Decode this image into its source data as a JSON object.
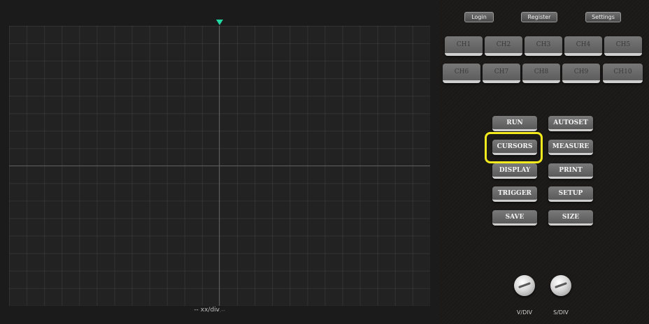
{
  "header": {
    "login_label": "Login",
    "register_label": "Register",
    "settings_label": "Settings"
  },
  "channels": [
    "CH1",
    "CH2",
    "CH3",
    "CH4",
    "CH5",
    "CH6",
    "CH7",
    "CH8",
    "CH9",
    "CH10"
  ],
  "controls": {
    "run": "RUN",
    "autoset": "AUTOSET",
    "cursors": "CURSORS",
    "measure": "MEASURE",
    "display": "DISPLAY",
    "print": "PRINT",
    "trigger": "TRIGGER",
    "setup": "SETUP",
    "save": "SAVE",
    "size": "SIZE"
  },
  "screen": {
    "time_readout": "--.--",
    "scale_readout": "-- xx/div"
  },
  "knobs": {
    "vdiv_label": "V/DIV",
    "sdiv_label": "S/DIV"
  },
  "colors": {
    "trigger_marker": "#23d9a3",
    "highlight": "#f2ea1c"
  }
}
